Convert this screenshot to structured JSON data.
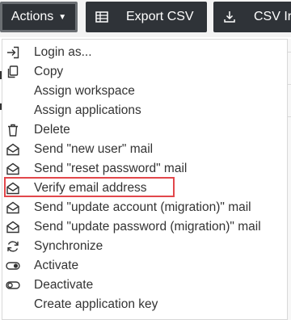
{
  "toolbar": {
    "actions_label": "Actions",
    "export_label": "Export CSV",
    "csv_import_label": "CSV Ir"
  },
  "menu": {
    "items": [
      {
        "label": "Login as...",
        "icon": "login-icon"
      },
      {
        "label": "Copy",
        "icon": "copy-icon"
      },
      {
        "label": "Assign workspace",
        "icon": ""
      },
      {
        "label": "Assign applications",
        "icon": ""
      },
      {
        "label": "Delete",
        "icon": "trash-icon"
      },
      {
        "label": "Send \"new user\" mail",
        "icon": "envelope-icon",
        "highlighted": true
      },
      {
        "label": "Send \"reset password\" mail",
        "icon": "envelope-icon"
      },
      {
        "label": "Verify email address",
        "icon": "envelope-icon"
      },
      {
        "label": "Send \"update account (migration)\" mail",
        "icon": "envelope-icon"
      },
      {
        "label": "Send \"update password (migration)\" mail",
        "icon": "envelope-icon"
      },
      {
        "label": "Synchronize",
        "icon": "sync-icon"
      },
      {
        "label": "Activate",
        "icon": "toggle-on-icon"
      },
      {
        "label": "Deactivate",
        "icon": "toggle-off-icon"
      },
      {
        "label": "Create application key",
        "icon": ""
      }
    ]
  },
  "colors": {
    "button_bg": "#2f3338",
    "highlight_border": "#e2474b",
    "text": "#333333"
  }
}
